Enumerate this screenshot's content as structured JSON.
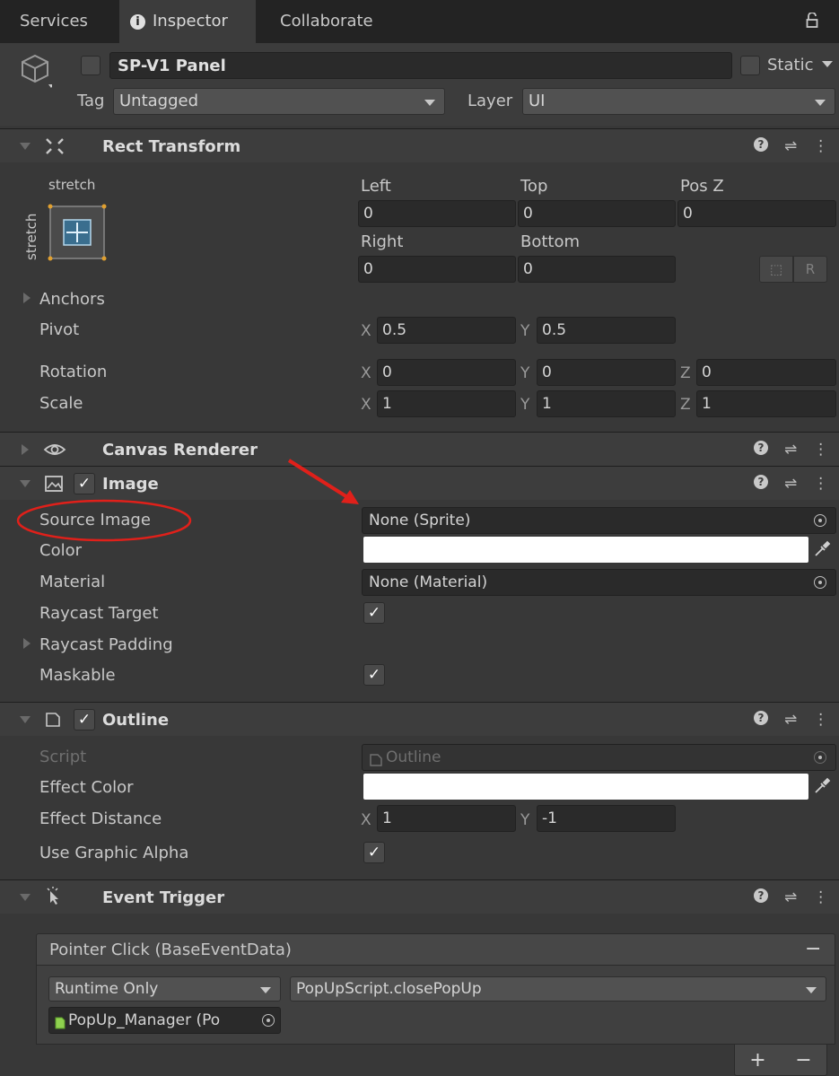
{
  "tabs": [
    "Services",
    "Inspector",
    "Collaborate"
  ],
  "lock_icon": "lock-icon",
  "header": {
    "object_name": "SP-V1 Panel",
    "static_label": "Static",
    "tag_label": "Tag",
    "tag_value": "Untagged",
    "layer_label": "Layer",
    "layer_value": "UI"
  },
  "rect_transform": {
    "title": "Rect Transform",
    "anchor_h": "stretch",
    "anchor_v": "stretch",
    "left_label": "Left",
    "left": "0",
    "top_label": "Top",
    "top": "0",
    "posz_label": "Pos Z",
    "posz": "0",
    "right_label": "Right",
    "right": "0",
    "bottom_label": "Bottom",
    "bottom": "0",
    "blueprint_btn": "⬚",
    "raw_btn": "R",
    "anchors_label": "Anchors",
    "pivot_label": "Pivot",
    "pivot_x": "0.5",
    "pivot_y": "0.5",
    "rotation_label": "Rotation",
    "rot_x": "0",
    "rot_y": "0",
    "rot_z": "0",
    "scale_label": "Scale",
    "scale_x": "1",
    "scale_y": "1",
    "scale_z": "1",
    "x": "X",
    "y": "Y",
    "z": "Z"
  },
  "canvas_renderer": {
    "title": "Canvas Renderer"
  },
  "image": {
    "title": "Image",
    "source_image_label": "Source Image",
    "source_image_value": "None (Sprite)",
    "color_label": "Color",
    "color_value": "#ffffff",
    "material_label": "Material",
    "material_value": "None (Material)",
    "raycast_target_label": "Raycast Target",
    "raycast_padding_label": "Raycast Padding",
    "maskable_label": "Maskable"
  },
  "outline": {
    "title": "Outline",
    "script_label": "Script",
    "script_value": "Outline",
    "effect_color_label": "Effect Color",
    "effect_distance_label": "Effect Distance",
    "dist_x": "1",
    "dist_y": "-1",
    "use_graphic_alpha_label": "Use Graphic Alpha"
  },
  "event_trigger": {
    "title": "Event Trigger",
    "event_name": "Pointer Click (BaseEventData)",
    "runtime": "Runtime Only",
    "function": "PopUpScript.closePopUp",
    "target_object": "PopUp_Manager (Po",
    "add": "+",
    "remove": "−",
    "remove_event": "−"
  },
  "colors": {
    "annotation": "#e0201a",
    "anchor_accent": "#4fa3d8"
  }
}
